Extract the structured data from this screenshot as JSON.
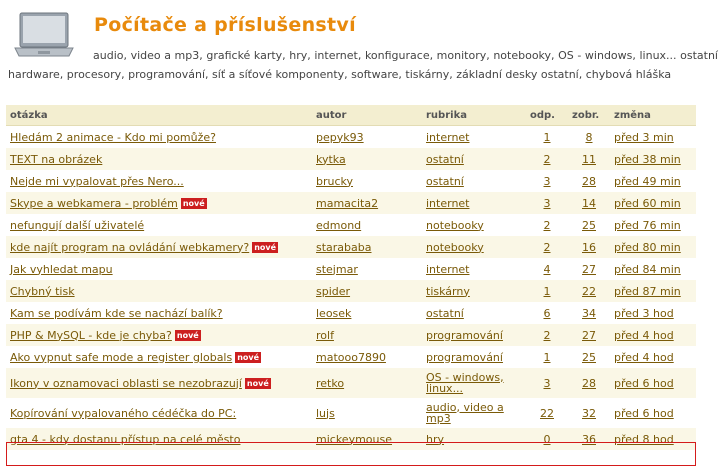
{
  "header": {
    "title": "Počítače a příslušenství",
    "subcategories": "audio, video a mp3, grafické karty, hry, internet, konfigurace, monitory, notebooky, OS - windows, linux... ostatní hardware, procesory, programování, síť a síťové komponenty, software, tiskárny, základní desky ostatní, chybová hláška",
    "laptop_icon": "laptop-icon"
  },
  "columns": {
    "question": "otázka",
    "author": "autor",
    "category": "rubrika",
    "replies": "odp.",
    "views": "zobr.",
    "changed": "změna"
  },
  "badge_label": "nové",
  "rows": [
    {
      "question": "Hledám 2 animace - Kdo mi pomůže?",
      "new": false,
      "author": "pepyk93",
      "category": "internet",
      "replies": "1",
      "views": "8",
      "changed": "před 3 min"
    },
    {
      "question": "TEXT na obrázek",
      "new": false,
      "author": "kytka",
      "category": "ostatní",
      "replies": "2",
      "views": "11",
      "changed": "před 38 min"
    },
    {
      "question": "Nejde mi vypalovat přes Nero...",
      "new": false,
      "author": "brucky",
      "category": "ostatní",
      "replies": "3",
      "views": "28",
      "changed": "před 49 min"
    },
    {
      "question": "Skype a webkamera - problém",
      "new": true,
      "author": "mamacita2",
      "category": "internet",
      "replies": "3",
      "views": "14",
      "changed": "před 60 min"
    },
    {
      "question": "nefungují další uživatelé",
      "new": false,
      "author": "edmond",
      "category": "notebooky",
      "replies": "2",
      "views": "25",
      "changed": "před 76 min"
    },
    {
      "question": "kde najít program na ovládání webkamery?",
      "new": true,
      "author": "starababa",
      "category": "notebooky",
      "replies": "2",
      "views": "16",
      "changed": "před 80 min"
    },
    {
      "question": "Jak vyhledat mapu",
      "new": false,
      "author": "stejmar",
      "category": "internet",
      "replies": "4",
      "views": "27",
      "changed": "před 84 min"
    },
    {
      "question": "Chybný tisk",
      "new": false,
      "author": "spider",
      "category": "tiskárny",
      "replies": "1",
      "views": "22",
      "changed": "před 87 min"
    },
    {
      "question": "Kam se podívám kde se nachází balík?",
      "new": false,
      "author": "leosek",
      "category": "ostatní",
      "replies": "6",
      "views": "34",
      "changed": "před 3 hod"
    },
    {
      "question": "PHP & MySQL - kde je chyba?",
      "new": true,
      "author": "rolf",
      "category": "programování",
      "replies": "2",
      "views": "27",
      "changed": "před 4 hod"
    },
    {
      "question": "Ako vypnut safe mode a register globals",
      "new": true,
      "author": "matooo7890",
      "category": "programování",
      "replies": "1",
      "views": "25",
      "changed": "před 4 hod"
    },
    {
      "question": "Ikony v oznamovaci oblasti se nezobrazují",
      "new": true,
      "author": "retko",
      "category": "OS - windows, linux...",
      "replies": "3",
      "views": "28",
      "changed": "před 6 hod"
    },
    {
      "question": "Kopírování vypalovaného cédéčka do PC:",
      "new": false,
      "author": "lujs",
      "category": "audio, video a mp3",
      "replies": "22",
      "views": "32",
      "changed": "před 6 hod"
    },
    {
      "question": "gta 4 - kdy dostanu přístup na celé město",
      "new": false,
      "author": "mickeymouse",
      "category": "hry",
      "replies": "0",
      "views": "36",
      "changed": "před 8 hod"
    }
  ],
  "colors": {
    "title": "#e88a0c",
    "link": "#7a5a08",
    "header_bg": "#f3eed0",
    "alt_row_bg": "#faf7e6",
    "badge_bg": "#cc1f1f",
    "highlight_border": "#d41b1b"
  }
}
